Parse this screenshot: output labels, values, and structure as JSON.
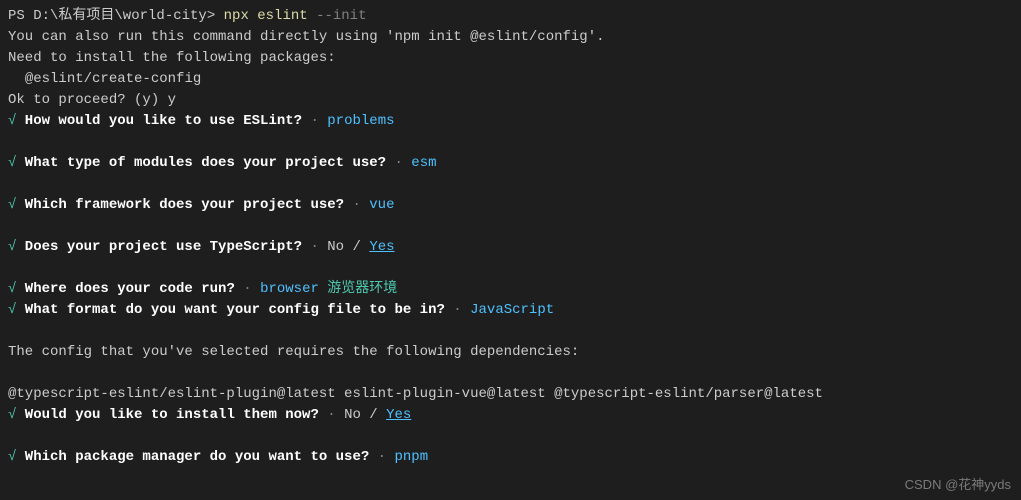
{
  "prompt": {
    "ps": "PS D:\\私有项目\\world-city> ",
    "cmd1": "npx eslint ",
    "cmd2": "--init"
  },
  "intro": {
    "line1": "You can also run this command directly using 'npm init @eslint/config'.",
    "line2": "Need to install the following packages:",
    "line3": "  @eslint/create-config",
    "line4": "Ok to proceed? (y) y"
  },
  "check": "√",
  "sep": " · ",
  "q1": {
    "text": " How would you like to use ESLint?",
    "answer": "problems"
  },
  "q2": {
    "text": " What type of modules does your project use?",
    "answer": "esm"
  },
  "q3": {
    "text": " Which framework does your project use?",
    "answer": "vue"
  },
  "q4": {
    "text": " Does your project use TypeScript?",
    "no": "No",
    "slash": " / ",
    "yes": "Yes"
  },
  "q5": {
    "text": " Where does your code run?",
    "answer": "browser",
    "note": " 游览器环境"
  },
  "q6": {
    "text": " What format do you want your config file to be in?",
    "answer": "JavaScript"
  },
  "deps": {
    "intro": "The config that you've selected requires the following dependencies:",
    "list": "@typescript-eslint/eslint-plugin@latest eslint-plugin-vue@latest @typescript-eslint/parser@latest"
  },
  "q7": {
    "text": " Would you like to install them now?",
    "no": "No",
    "slash": " / ",
    "yes": "Yes"
  },
  "q8": {
    "text": " Which package manager do you want to use?",
    "answer": "pnpm"
  },
  "watermark": "CSDN @花神yyds"
}
